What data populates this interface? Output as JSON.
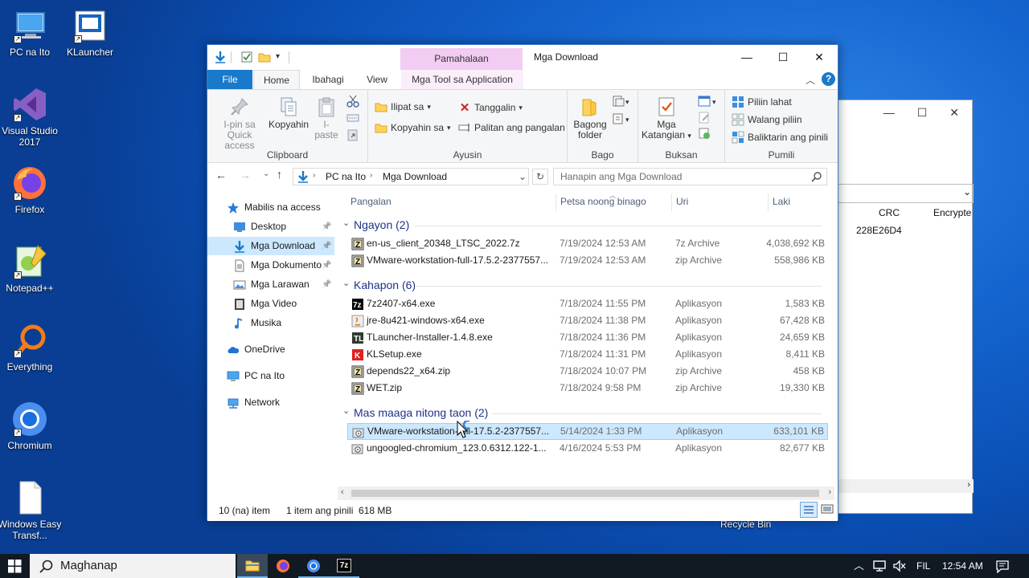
{
  "desktop": {
    "icons": [
      {
        "label": "PC na Ito",
        "icon": "computer-icon"
      },
      {
        "label": "KLauncher",
        "icon": "klauncher-icon"
      },
      {
        "label": "Visual Studio 2017",
        "icon": "visual-studio-icon"
      },
      {
        "label": "Firefox",
        "icon": "firefox-icon"
      },
      {
        "label": "Notepad++",
        "icon": "notepadpp-icon"
      },
      {
        "label": "Everything",
        "icon": "everything-search-icon"
      },
      {
        "label": "Chromium",
        "icon": "chromium-icon"
      },
      {
        "label": "Windows Easy Transf...",
        "icon": "document-icon"
      }
    ],
    "recycle_bin": "Recycle Bin"
  },
  "background_window": {
    "col_crc": "CRC",
    "col_encrypted": "Encrypte",
    "crc_value": "228E26D4"
  },
  "explorer": {
    "title": "Mga Download",
    "context_tab": "Pamahalaan",
    "tabs": {
      "file": "File",
      "home": "Home",
      "share": "Ibahagi",
      "view": "View",
      "app_tools": "Mga Tool sa Application"
    },
    "ribbon": {
      "clipboard": {
        "label": "Clipboard",
        "pin": "I-pin sa Quick access",
        "copy": "Kopyahin",
        "paste": "I-paste"
      },
      "organize": {
        "label": "Ayusin",
        "move_to": "Ilipat sa",
        "copy_to": "Kopyahin sa",
        "delete": "Tanggalin",
        "rename": "Palitan ang pangalan"
      },
      "new": {
        "label": "Bago",
        "new_folder": "Bagong folder"
      },
      "open": {
        "label": "Buksan",
        "properties": "Mga Katangian"
      },
      "select": {
        "label": "Pumili",
        "select_all": "Piliin lahat",
        "select_none": "Walang piliin",
        "invert": "Baliktarin ang pinili"
      }
    },
    "address": {
      "crumbs": [
        "PC na Ito",
        "Mga Download"
      ],
      "search_placeholder": "Hanapin ang Mga Download"
    },
    "nav": [
      {
        "label": "Mabilis na access",
        "icon": "star-icon",
        "indent": 0,
        "pinned": false
      },
      {
        "label": "Desktop",
        "icon": "desktop-folder-icon",
        "indent": 1,
        "pinned": true
      },
      {
        "label": "Mga Download",
        "icon": "download-folder-icon",
        "indent": 1,
        "pinned": true,
        "selected": true
      },
      {
        "label": "Mga Dokumento",
        "icon": "documents-folder-icon",
        "indent": 1,
        "pinned": true
      },
      {
        "label": "Mga Larawan",
        "icon": "pictures-folder-icon",
        "indent": 1,
        "pinned": true
      },
      {
        "label": "Mga Video",
        "icon": "videos-folder-icon",
        "indent": 1,
        "pinned": false
      },
      {
        "label": "Musika",
        "icon": "music-folder-icon",
        "indent": 1,
        "pinned": false
      },
      {
        "label": "OneDrive",
        "icon": "onedrive-icon",
        "indent": 0,
        "pinned": false
      },
      {
        "label": "PC na Ito",
        "icon": "computer-icon",
        "indent": 0,
        "pinned": false
      },
      {
        "label": "Network",
        "icon": "network-icon",
        "indent": 0,
        "pinned": false
      }
    ],
    "columns": {
      "name": "Pangalan",
      "date": "Petsa noong binago",
      "type": "Uri",
      "size": "Laki"
    },
    "groups": [
      {
        "title": "Ngayon (2)",
        "files": [
          {
            "name": "en-us_client_20348_LTSC_2022.7z",
            "date": "7/19/2024 12:53 AM",
            "type": "7z Archive",
            "size": "4,038,692 KB",
            "icon": "archive-icon"
          },
          {
            "name": "VMware-workstation-full-17.5.2-2377557...",
            "date": "7/19/2024 12:53 AM",
            "type": "zip Archive",
            "size": "558,986 KB",
            "icon": "archive-icon"
          }
        ]
      },
      {
        "title": "Kahapon (6)",
        "files": [
          {
            "name": "7z2407-x64.exe",
            "date": "7/18/2024 11:55 PM",
            "type": "Aplikasyon",
            "size": "1,583 KB",
            "icon": "7zip-icon"
          },
          {
            "name": "jre-8u421-windows-x64.exe",
            "date": "7/18/2024 11:38 PM",
            "type": "Aplikasyon",
            "size": "67,428 KB",
            "icon": "java-icon"
          },
          {
            "name": "TLauncher-Installer-1.4.8.exe",
            "date": "7/18/2024 11:36 PM",
            "type": "Aplikasyon",
            "size": "24,659 KB",
            "icon": "tlauncher-icon"
          },
          {
            "name": "KLSetup.exe",
            "date": "7/18/2024 11:31 PM",
            "type": "Aplikasyon",
            "size": "8,411 KB",
            "icon": "klsetup-icon"
          },
          {
            "name": "depends22_x64.zip",
            "date": "7/18/2024 10:07 PM",
            "type": "zip Archive",
            "size": "458 KB",
            "icon": "archive-icon"
          },
          {
            "name": "WET.zip",
            "date": "7/18/2024 9:58 PM",
            "type": "zip Archive",
            "size": "19,330 KB",
            "icon": "archive-icon"
          }
        ]
      },
      {
        "title": "Mas maaga nitong taon (2)",
        "files": [
          {
            "name": "VMware-workstation-full-17.5.2-2377557...",
            "date": "5/14/2024 1:33 PM",
            "type": "Aplikasyon",
            "size": "633,101 KB",
            "icon": "installer-icon",
            "selected": true
          },
          {
            "name": "ungoogled-chromium_123.0.6312.122-1...",
            "date": "4/16/2024 5:53 PM",
            "type": "Aplikasyon",
            "size": "82,677 KB",
            "icon": "installer-icon"
          }
        ]
      }
    ],
    "status": {
      "count": "10 (na) item",
      "selection": "1 item ang pinili  618 MB"
    }
  },
  "taskbar": {
    "search_placeholder": "Maghanap",
    "language": "FIL",
    "time": "12:54 AM",
    "apps": [
      "file-explorer-icon",
      "firefox-icon",
      "chromium-icon",
      "7zip-icon"
    ]
  },
  "colors": {
    "accent": "#1979ca",
    "selection": "#cce8ff",
    "context_tab": "#f2ccf2",
    "taskbar": "#111923"
  }
}
